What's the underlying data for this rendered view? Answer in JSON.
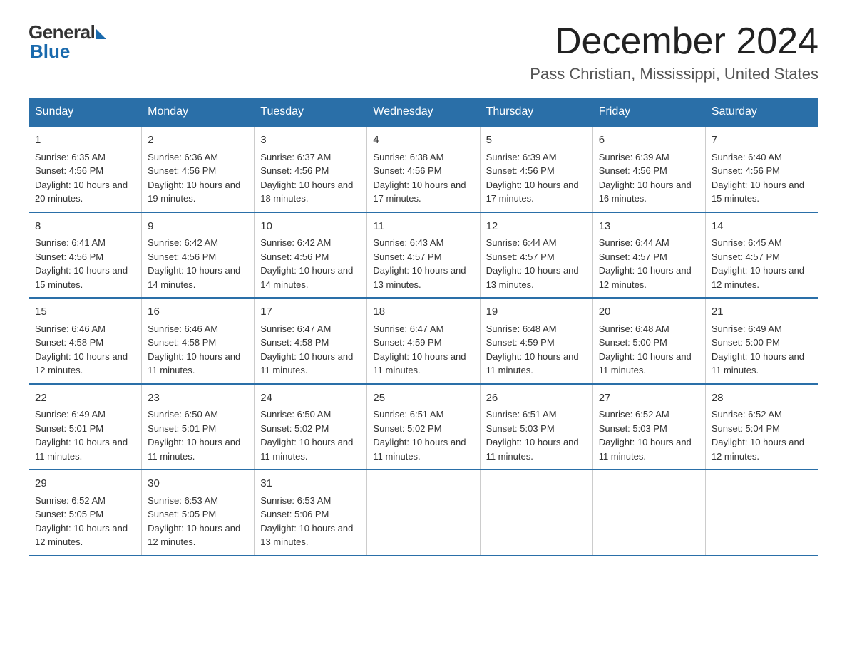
{
  "header": {
    "logo_general": "General",
    "logo_blue": "Blue",
    "month_title": "December 2024",
    "location": "Pass Christian, Mississippi, United States"
  },
  "days_of_week": [
    "Sunday",
    "Monday",
    "Tuesday",
    "Wednesday",
    "Thursday",
    "Friday",
    "Saturday"
  ],
  "weeks": [
    [
      {
        "day": "1",
        "sunrise": "6:35 AM",
        "sunset": "4:56 PM",
        "daylight": "10 hours and 20 minutes."
      },
      {
        "day": "2",
        "sunrise": "6:36 AM",
        "sunset": "4:56 PM",
        "daylight": "10 hours and 19 minutes."
      },
      {
        "day": "3",
        "sunrise": "6:37 AM",
        "sunset": "4:56 PM",
        "daylight": "10 hours and 18 minutes."
      },
      {
        "day": "4",
        "sunrise": "6:38 AM",
        "sunset": "4:56 PM",
        "daylight": "10 hours and 17 minutes."
      },
      {
        "day": "5",
        "sunrise": "6:39 AM",
        "sunset": "4:56 PM",
        "daylight": "10 hours and 17 minutes."
      },
      {
        "day": "6",
        "sunrise": "6:39 AM",
        "sunset": "4:56 PM",
        "daylight": "10 hours and 16 minutes."
      },
      {
        "day": "7",
        "sunrise": "6:40 AM",
        "sunset": "4:56 PM",
        "daylight": "10 hours and 15 minutes."
      }
    ],
    [
      {
        "day": "8",
        "sunrise": "6:41 AM",
        "sunset": "4:56 PM",
        "daylight": "10 hours and 15 minutes."
      },
      {
        "day": "9",
        "sunrise": "6:42 AM",
        "sunset": "4:56 PM",
        "daylight": "10 hours and 14 minutes."
      },
      {
        "day": "10",
        "sunrise": "6:42 AM",
        "sunset": "4:56 PM",
        "daylight": "10 hours and 14 minutes."
      },
      {
        "day": "11",
        "sunrise": "6:43 AM",
        "sunset": "4:57 PM",
        "daylight": "10 hours and 13 minutes."
      },
      {
        "day": "12",
        "sunrise": "6:44 AM",
        "sunset": "4:57 PM",
        "daylight": "10 hours and 13 minutes."
      },
      {
        "day": "13",
        "sunrise": "6:44 AM",
        "sunset": "4:57 PM",
        "daylight": "10 hours and 12 minutes."
      },
      {
        "day": "14",
        "sunrise": "6:45 AM",
        "sunset": "4:57 PM",
        "daylight": "10 hours and 12 minutes."
      }
    ],
    [
      {
        "day": "15",
        "sunrise": "6:46 AM",
        "sunset": "4:58 PM",
        "daylight": "10 hours and 12 minutes."
      },
      {
        "day": "16",
        "sunrise": "6:46 AM",
        "sunset": "4:58 PM",
        "daylight": "10 hours and 11 minutes."
      },
      {
        "day": "17",
        "sunrise": "6:47 AM",
        "sunset": "4:58 PM",
        "daylight": "10 hours and 11 minutes."
      },
      {
        "day": "18",
        "sunrise": "6:47 AM",
        "sunset": "4:59 PM",
        "daylight": "10 hours and 11 minutes."
      },
      {
        "day": "19",
        "sunrise": "6:48 AM",
        "sunset": "4:59 PM",
        "daylight": "10 hours and 11 minutes."
      },
      {
        "day": "20",
        "sunrise": "6:48 AM",
        "sunset": "5:00 PM",
        "daylight": "10 hours and 11 minutes."
      },
      {
        "day": "21",
        "sunrise": "6:49 AM",
        "sunset": "5:00 PM",
        "daylight": "10 hours and 11 minutes."
      }
    ],
    [
      {
        "day": "22",
        "sunrise": "6:49 AM",
        "sunset": "5:01 PM",
        "daylight": "10 hours and 11 minutes."
      },
      {
        "day": "23",
        "sunrise": "6:50 AM",
        "sunset": "5:01 PM",
        "daylight": "10 hours and 11 minutes."
      },
      {
        "day": "24",
        "sunrise": "6:50 AM",
        "sunset": "5:02 PM",
        "daylight": "10 hours and 11 minutes."
      },
      {
        "day": "25",
        "sunrise": "6:51 AM",
        "sunset": "5:02 PM",
        "daylight": "10 hours and 11 minutes."
      },
      {
        "day": "26",
        "sunrise": "6:51 AM",
        "sunset": "5:03 PM",
        "daylight": "10 hours and 11 minutes."
      },
      {
        "day": "27",
        "sunrise": "6:52 AM",
        "sunset": "5:03 PM",
        "daylight": "10 hours and 11 minutes."
      },
      {
        "day": "28",
        "sunrise": "6:52 AM",
        "sunset": "5:04 PM",
        "daylight": "10 hours and 12 minutes."
      }
    ],
    [
      {
        "day": "29",
        "sunrise": "6:52 AM",
        "sunset": "5:05 PM",
        "daylight": "10 hours and 12 minutes."
      },
      {
        "day": "30",
        "sunrise": "6:53 AM",
        "sunset": "5:05 PM",
        "daylight": "10 hours and 12 minutes."
      },
      {
        "day": "31",
        "sunrise": "6:53 AM",
        "sunset": "5:06 PM",
        "daylight": "10 hours and 13 minutes."
      },
      null,
      null,
      null,
      null
    ]
  ]
}
